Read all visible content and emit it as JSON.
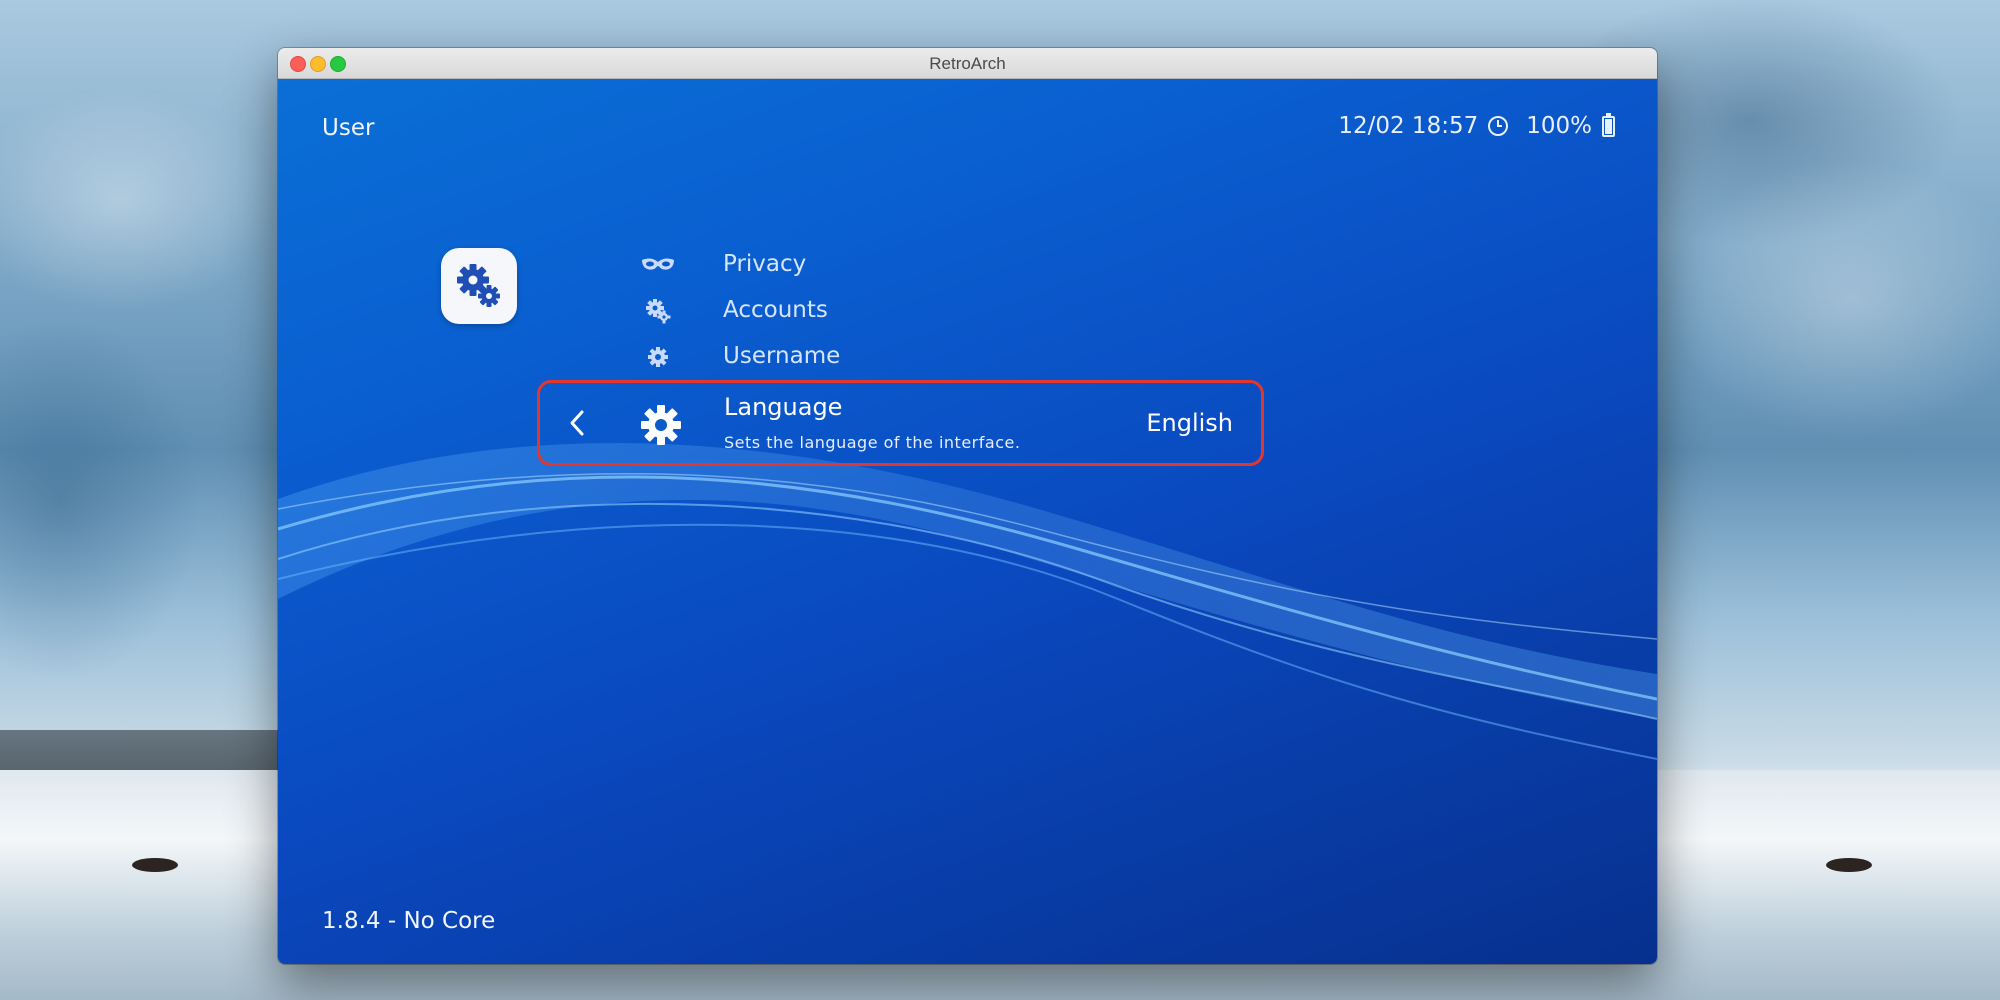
{
  "window": {
    "title": "RetroArch"
  },
  "header": {
    "section": "User",
    "datetime": "12/02 18:57",
    "battery": "100%"
  },
  "category": {
    "icon": "settings-gears-icon"
  },
  "menu": {
    "items": [
      {
        "label": "Privacy",
        "icon": "mask-icon"
      },
      {
        "label": "Accounts",
        "icon": "gears-icon"
      },
      {
        "label": "Username",
        "icon": "gear-icon"
      }
    ],
    "selected": {
      "label": "Language",
      "description": "Sets the language of the interface.",
      "value": "English",
      "icon": "gear-icon"
    }
  },
  "footer": {
    "version": "1.8.4 - No Core"
  },
  "colors": {
    "accent_border": "#e2372f",
    "background_top": "#0a6fd6",
    "background_bottom": "#07308e"
  }
}
